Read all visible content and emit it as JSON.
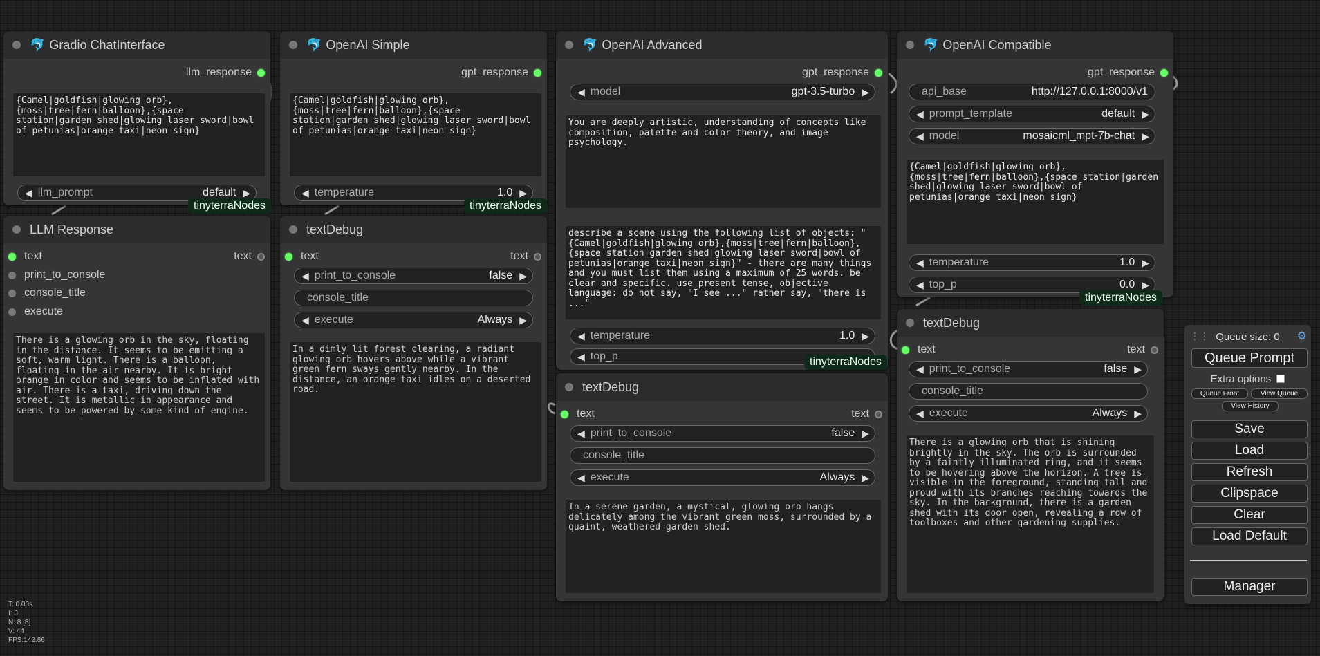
{
  "nodes": {
    "gradio": {
      "title": "Gradio ChatInterface",
      "output": "llm_response",
      "prompt_text": "{Camel|goldfish|glowing orb},\n{moss|tree|fern|balloon},{space station|garden shed|glowing laser sword|bowl of petunias|orange taxi|neon sign}",
      "widget_label": "llm_prompt",
      "widget_value": "default",
      "badge": "tinyterraNodes"
    },
    "openai_simple": {
      "title": "OpenAI Simple",
      "output": "gpt_response",
      "prompt_text": "{Camel|goldfish|glowing orb},\n{moss|tree|fern|balloon},{space station|garden shed|glowing laser sword|bowl of petunias|orange taxi|neon sign}",
      "widget_label": "temperature",
      "widget_value": "1.0",
      "badge": "tinyterraNodes"
    },
    "openai_advanced": {
      "title": "OpenAI Advanced",
      "output": "gpt_response",
      "model_label": "model",
      "model_value": "gpt-3.5-turbo",
      "system_text": "You are deeply artistic, understanding of concepts like composition, palette and color theory, and image psychology.",
      "prompt_text": "describe a scene using the following list of objects: \"{Camel|goldfish|glowing orb},{moss|tree|fern|balloon},{space station|garden shed|glowing laser sword|bowl of petunias|orange taxi|neon sign}\" - there are many things and you must list them using a maximum of 25 words. be clear and specific. use present tense, objective language: do not say, \"I see ...\" rather say, \"there is ...\"",
      "temperature_label": "temperature",
      "temperature_value": "1.0",
      "top_p_label": "top_p",
      "badge": "tinyterraNodes"
    },
    "openai_compatible": {
      "title": "OpenAI Compatible",
      "output": "gpt_response",
      "api_base_label": "api_base",
      "api_base_value": "http://127.0.0.1:8000/v1",
      "prompt_template_label": "prompt_template",
      "prompt_template_value": "default",
      "model_label": "model",
      "model_value": "mosaicml_mpt-7b-chat",
      "prompt_text": "{Camel|goldfish|glowing orb},\n{moss|tree|fern|balloon},{space station|garden shed|glowing laser sword|bowl of petunias|orange taxi|neon sign}",
      "temperature_label": "temperature",
      "temperature_value": "1.0",
      "top_p_label": "top_p",
      "top_p_value": "0.0",
      "badge": "tinyterraNodes"
    },
    "llm_response": {
      "title": "LLM Response",
      "in_text": "text",
      "out_text": "text",
      "in_print": "print_to_console",
      "in_console_title": "console_title",
      "in_execute": "execute",
      "output_text": "There is a glowing orb in the sky, floating in the distance. It seems to be emitting a soft, warm light. There is a balloon, floating in the air nearby. It is bright orange in color and seems to be inflated with air. There is a taxi, driving down the street. It is metallic in appearance and seems to be powered by some kind of engine."
    },
    "textdebug1": {
      "title": "textDebug",
      "in_text": "text",
      "out_text": "text",
      "print_label": "print_to_console",
      "print_value": "false",
      "console_title": "console_title",
      "execute_label": "execute",
      "execute_value": "Always",
      "output_text": "In a dimly lit forest clearing, a radiant glowing orb hovers above while a vibrant green fern sways gently nearby. In the distance, an orange taxi idles on a deserted road."
    },
    "textdebug2": {
      "title": "textDebug",
      "in_text": "text",
      "out_text": "text",
      "print_label": "print_to_console",
      "print_value": "false",
      "console_title": "console_title",
      "execute_label": "execute",
      "execute_value": "Always",
      "output_text": "In a serene garden, a mystical, glowing orb hangs delicately among the vibrant green moss, surrounded by a quaint, weathered garden shed."
    },
    "textdebug3": {
      "title": "textDebug",
      "in_text": "text",
      "out_text": "text",
      "print_label": "print_to_console",
      "print_value": "false",
      "console_title": "console_title",
      "execute_label": "execute",
      "execute_value": "Always",
      "output_text": "There is a glowing orb that is shining brightly in the sky. The orb is surrounded by a faintly illuminated ring, and it seems to be hovering above the horizon. A tree is visible in the foreground, standing tall and proud with its branches reaching towards the sky. In the background, there is a garden shed with its door open, revealing a row of toolboxes and other gardening supplies."
    }
  },
  "menu": {
    "queue_size": "Queue size: 0",
    "queue_prompt": "Queue Prompt",
    "extra_options": "Extra options",
    "queue_front": "Queue Front",
    "view_queue": "View Queue",
    "view_history": "View History",
    "save": "Save",
    "load": "Load",
    "refresh": "Refresh",
    "clipspace": "Clipspace",
    "clear": "Clear",
    "load_default": "Load Default",
    "manager": "Manager"
  },
  "stats": {
    "t": "T: 0.00s",
    "i": "I: 0",
    "n": "N: 8 [8]",
    "v": "V: 44",
    "fps": "FPS:142.86"
  },
  "colors": {
    "canvas_bg": "#202020",
    "node_bg": "#353535",
    "badge_bg": "#0f2a1a",
    "slot_green": "#66ff66"
  },
  "icons": {
    "node_icon": "dolphin-icon",
    "arrow_left": "◀",
    "arrow_right": "▶"
  }
}
